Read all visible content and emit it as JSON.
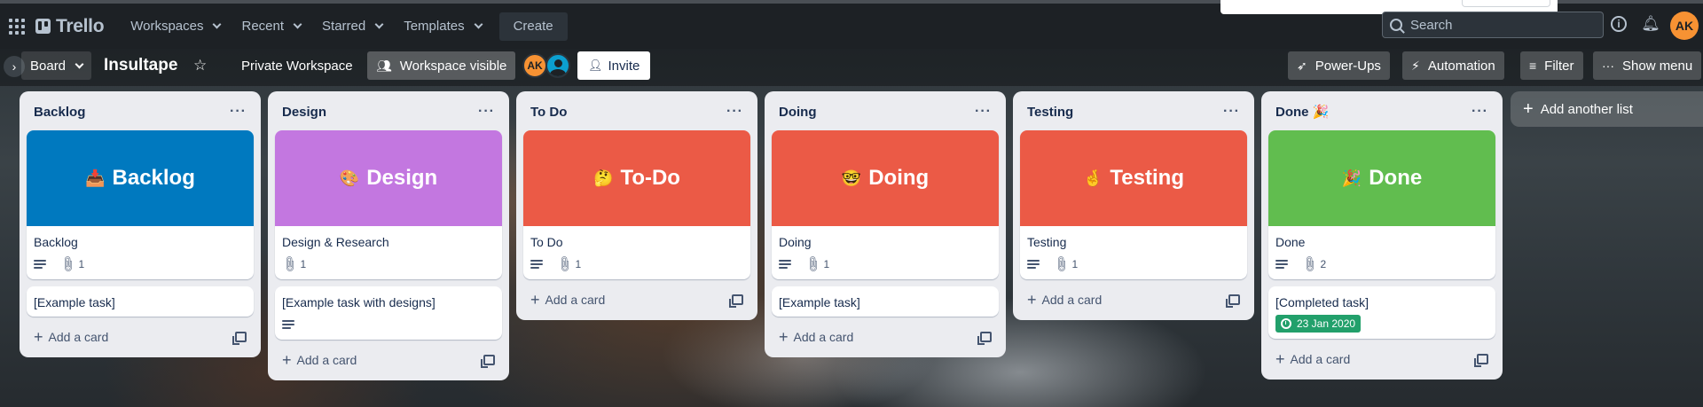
{
  "topbar": {
    "app_name": "Trello",
    "nav": [
      "Workspaces",
      "Recent",
      "Starred",
      "Templates"
    ],
    "create_label": "Create",
    "search_placeholder": "Search",
    "user_initials": "AK"
  },
  "board_header": {
    "view_label": "Board",
    "board_title": "Insultape",
    "workspace_label": "Private Workspace",
    "visibility_label": "Workspace visible",
    "member_initials": "AK",
    "invite_label": "Invite",
    "powerups_label": "Power-Ups",
    "automation_label": "Automation",
    "filter_label": "Filter",
    "show_menu_label": "Show menu"
  },
  "lists": [
    {
      "title": "Backlog",
      "cover": {
        "color": "#0079bf",
        "emoji": "📥",
        "text": "Backlog"
      },
      "cover_card": {
        "title": "Backlog",
        "has_description": true,
        "attachments": "1"
      },
      "cards": [
        {
          "title": "[Example task]"
        }
      ],
      "add_card_label": "Add a card"
    },
    {
      "title": "Design",
      "cover": {
        "color": "#c377e0",
        "emoji": "🎨",
        "text": "Design"
      },
      "cover_card": {
        "title": "Design & Research",
        "has_description": false,
        "attachments": "1"
      },
      "cards": [
        {
          "title": "[Example task with designs]",
          "has_description": true
        }
      ],
      "add_card_label": "Add a card"
    },
    {
      "title": "To Do",
      "cover": {
        "color": "#eb5a46",
        "emoji": "🤔",
        "text": "To-Do"
      },
      "cover_card": {
        "title": "To Do",
        "has_description": true,
        "attachments": "1"
      },
      "cards": [],
      "add_card_label": "Add a card"
    },
    {
      "title": "Doing",
      "cover": {
        "color": "#eb5a46",
        "emoji": "🤓",
        "text": "Doing"
      },
      "cover_card": {
        "title": "Doing",
        "has_description": true,
        "attachments": "1"
      },
      "cards": [
        {
          "title": "[Example task]"
        }
      ],
      "add_card_label": "Add a card"
    },
    {
      "title": "Testing",
      "cover": {
        "color": "#eb5a46",
        "emoji": "🤞",
        "text": "Testing"
      },
      "cover_card": {
        "title": "Testing",
        "has_description": true,
        "attachments": "1"
      },
      "cards": [],
      "add_card_label": "Add a card"
    },
    {
      "title": "Done 🎉",
      "cover": {
        "color": "#61bd4f",
        "emoji": "🎉",
        "text": "Done"
      },
      "cover_card": {
        "title": "Done",
        "has_description": true,
        "attachments": "2"
      },
      "cards": [
        {
          "title": "[Completed task]",
          "due_date": "23 Jan 2020"
        }
      ],
      "add_card_label": "Add a card"
    }
  ],
  "add_list_label": "Add another list"
}
